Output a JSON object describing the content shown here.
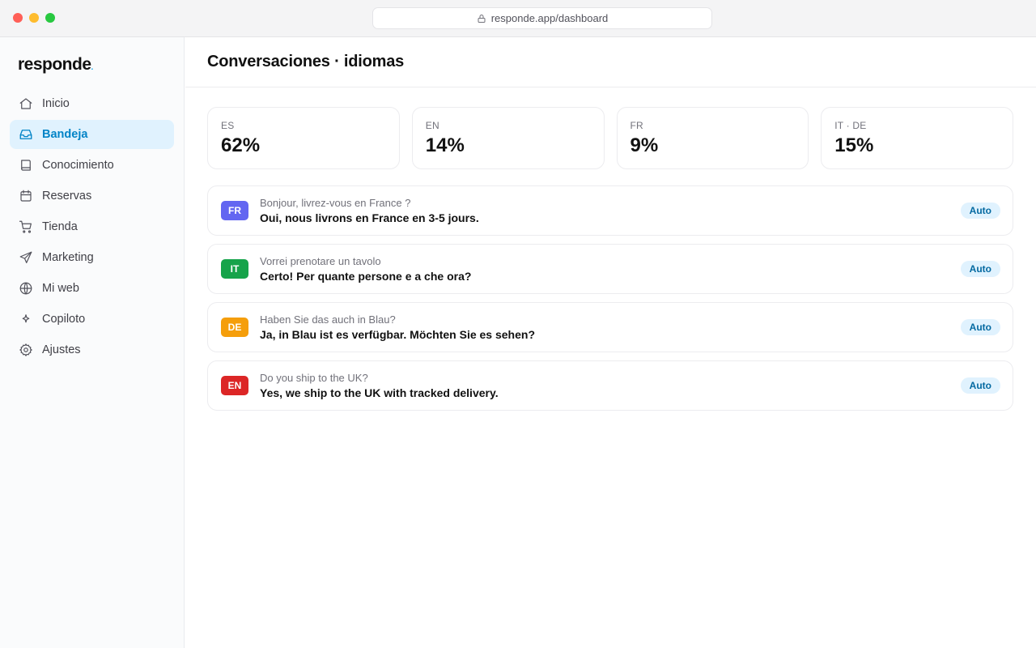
{
  "browser": {
    "url": "responde.app/dashboard"
  },
  "brand": {
    "name": "responde",
    "accent": "#0ea5e9"
  },
  "sidebar": {
    "items": [
      {
        "label": "Inicio",
        "icon": "home-icon"
      },
      {
        "label": "Bandeja",
        "icon": "inbox-icon",
        "active": true
      },
      {
        "label": "Conocimiento",
        "icon": "book-icon"
      },
      {
        "label": "Reservas",
        "icon": "calendar-icon"
      },
      {
        "label": "Tienda",
        "icon": "cart-icon"
      },
      {
        "label": "Marketing",
        "icon": "send-icon"
      },
      {
        "label": "Mi web",
        "icon": "globe-icon"
      },
      {
        "label": "Copiloto",
        "icon": "sparkle-icon"
      },
      {
        "label": "Ajustes",
        "icon": "gear-icon"
      }
    ]
  },
  "header": {
    "title": "Conversaciones · idiomas"
  },
  "stats": [
    {
      "label": "ES",
      "value": "62%"
    },
    {
      "label": "EN",
      "value": "14%"
    },
    {
      "label": "FR",
      "value": "9%"
    },
    {
      "label": "IT · DE",
      "value": "15%"
    }
  ],
  "conversations": [
    {
      "lang": "FR",
      "color": "#6366f1",
      "incoming": "Bonjour, livrez-vous en France ?",
      "reply": "Oui, nous livrons en France en 3-5 jours.",
      "status": "Auto"
    },
    {
      "lang": "IT",
      "color": "#16a34a",
      "incoming": "Vorrei prenotare un tavolo",
      "reply": "Certo! Per quante persone e a che ora?",
      "status": "Auto"
    },
    {
      "lang": "DE",
      "color": "#f59e0b",
      "incoming": "Haben Sie das auch in Blau?",
      "reply": "Ja, in Blau ist es verfügbar. Möchten Sie es sehen?",
      "status": "Auto"
    },
    {
      "lang": "EN",
      "color": "#dc2626",
      "incoming": "Do you ship to the UK?",
      "reply": "Yes, we ship to the UK with tracked delivery.",
      "status": "Auto"
    }
  ]
}
